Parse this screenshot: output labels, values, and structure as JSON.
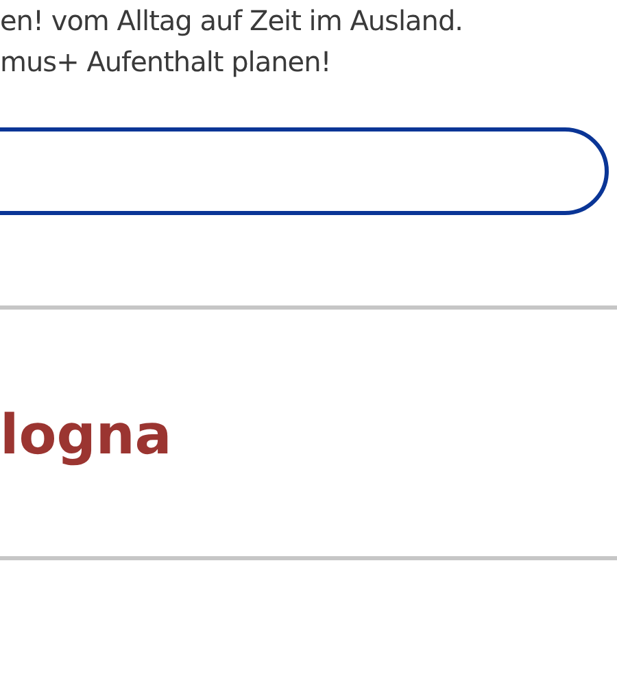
{
  "intro": {
    "lines": [
      "en! vom Alltag auf Zeit im Ausland.",
      "mus+ Aufenthalt planen!"
    ]
  },
  "result": {
    "heading": "logna"
  }
}
